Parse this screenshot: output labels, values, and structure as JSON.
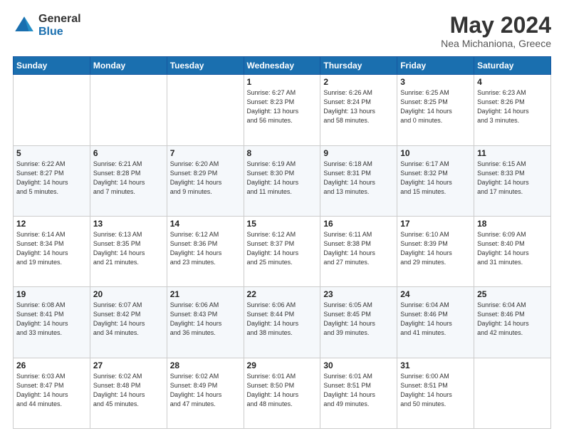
{
  "header": {
    "logo_general": "General",
    "logo_blue": "Blue",
    "month_title": "May 2024",
    "location": "Nea Michaniona, Greece"
  },
  "weekdays": [
    "Sunday",
    "Monday",
    "Tuesday",
    "Wednesday",
    "Thursday",
    "Friday",
    "Saturday"
  ],
  "weeks": [
    [
      {
        "day": "",
        "info": ""
      },
      {
        "day": "",
        "info": ""
      },
      {
        "day": "",
        "info": ""
      },
      {
        "day": "1",
        "info": "Sunrise: 6:27 AM\nSunset: 8:23 PM\nDaylight: 13 hours\nand 56 minutes."
      },
      {
        "day": "2",
        "info": "Sunrise: 6:26 AM\nSunset: 8:24 PM\nDaylight: 13 hours\nand 58 minutes."
      },
      {
        "day": "3",
        "info": "Sunrise: 6:25 AM\nSunset: 8:25 PM\nDaylight: 14 hours\nand 0 minutes."
      },
      {
        "day": "4",
        "info": "Sunrise: 6:23 AM\nSunset: 8:26 PM\nDaylight: 14 hours\nand 3 minutes."
      }
    ],
    [
      {
        "day": "5",
        "info": "Sunrise: 6:22 AM\nSunset: 8:27 PM\nDaylight: 14 hours\nand 5 minutes."
      },
      {
        "day": "6",
        "info": "Sunrise: 6:21 AM\nSunset: 8:28 PM\nDaylight: 14 hours\nand 7 minutes."
      },
      {
        "day": "7",
        "info": "Sunrise: 6:20 AM\nSunset: 8:29 PM\nDaylight: 14 hours\nand 9 minutes."
      },
      {
        "day": "8",
        "info": "Sunrise: 6:19 AM\nSunset: 8:30 PM\nDaylight: 14 hours\nand 11 minutes."
      },
      {
        "day": "9",
        "info": "Sunrise: 6:18 AM\nSunset: 8:31 PM\nDaylight: 14 hours\nand 13 minutes."
      },
      {
        "day": "10",
        "info": "Sunrise: 6:17 AM\nSunset: 8:32 PM\nDaylight: 14 hours\nand 15 minutes."
      },
      {
        "day": "11",
        "info": "Sunrise: 6:15 AM\nSunset: 8:33 PM\nDaylight: 14 hours\nand 17 minutes."
      }
    ],
    [
      {
        "day": "12",
        "info": "Sunrise: 6:14 AM\nSunset: 8:34 PM\nDaylight: 14 hours\nand 19 minutes."
      },
      {
        "day": "13",
        "info": "Sunrise: 6:13 AM\nSunset: 8:35 PM\nDaylight: 14 hours\nand 21 minutes."
      },
      {
        "day": "14",
        "info": "Sunrise: 6:12 AM\nSunset: 8:36 PM\nDaylight: 14 hours\nand 23 minutes."
      },
      {
        "day": "15",
        "info": "Sunrise: 6:12 AM\nSunset: 8:37 PM\nDaylight: 14 hours\nand 25 minutes."
      },
      {
        "day": "16",
        "info": "Sunrise: 6:11 AM\nSunset: 8:38 PM\nDaylight: 14 hours\nand 27 minutes."
      },
      {
        "day": "17",
        "info": "Sunrise: 6:10 AM\nSunset: 8:39 PM\nDaylight: 14 hours\nand 29 minutes."
      },
      {
        "day": "18",
        "info": "Sunrise: 6:09 AM\nSunset: 8:40 PM\nDaylight: 14 hours\nand 31 minutes."
      }
    ],
    [
      {
        "day": "19",
        "info": "Sunrise: 6:08 AM\nSunset: 8:41 PM\nDaylight: 14 hours\nand 33 minutes."
      },
      {
        "day": "20",
        "info": "Sunrise: 6:07 AM\nSunset: 8:42 PM\nDaylight: 14 hours\nand 34 minutes."
      },
      {
        "day": "21",
        "info": "Sunrise: 6:06 AM\nSunset: 8:43 PM\nDaylight: 14 hours\nand 36 minutes."
      },
      {
        "day": "22",
        "info": "Sunrise: 6:06 AM\nSunset: 8:44 PM\nDaylight: 14 hours\nand 38 minutes."
      },
      {
        "day": "23",
        "info": "Sunrise: 6:05 AM\nSunset: 8:45 PM\nDaylight: 14 hours\nand 39 minutes."
      },
      {
        "day": "24",
        "info": "Sunrise: 6:04 AM\nSunset: 8:46 PM\nDaylight: 14 hours\nand 41 minutes."
      },
      {
        "day": "25",
        "info": "Sunrise: 6:04 AM\nSunset: 8:46 PM\nDaylight: 14 hours\nand 42 minutes."
      }
    ],
    [
      {
        "day": "26",
        "info": "Sunrise: 6:03 AM\nSunset: 8:47 PM\nDaylight: 14 hours\nand 44 minutes."
      },
      {
        "day": "27",
        "info": "Sunrise: 6:02 AM\nSunset: 8:48 PM\nDaylight: 14 hours\nand 45 minutes."
      },
      {
        "day": "28",
        "info": "Sunrise: 6:02 AM\nSunset: 8:49 PM\nDaylight: 14 hours\nand 47 minutes."
      },
      {
        "day": "29",
        "info": "Sunrise: 6:01 AM\nSunset: 8:50 PM\nDaylight: 14 hours\nand 48 minutes."
      },
      {
        "day": "30",
        "info": "Sunrise: 6:01 AM\nSunset: 8:51 PM\nDaylight: 14 hours\nand 49 minutes."
      },
      {
        "day": "31",
        "info": "Sunrise: 6:00 AM\nSunset: 8:51 PM\nDaylight: 14 hours\nand 50 minutes."
      },
      {
        "day": "",
        "info": ""
      }
    ]
  ]
}
